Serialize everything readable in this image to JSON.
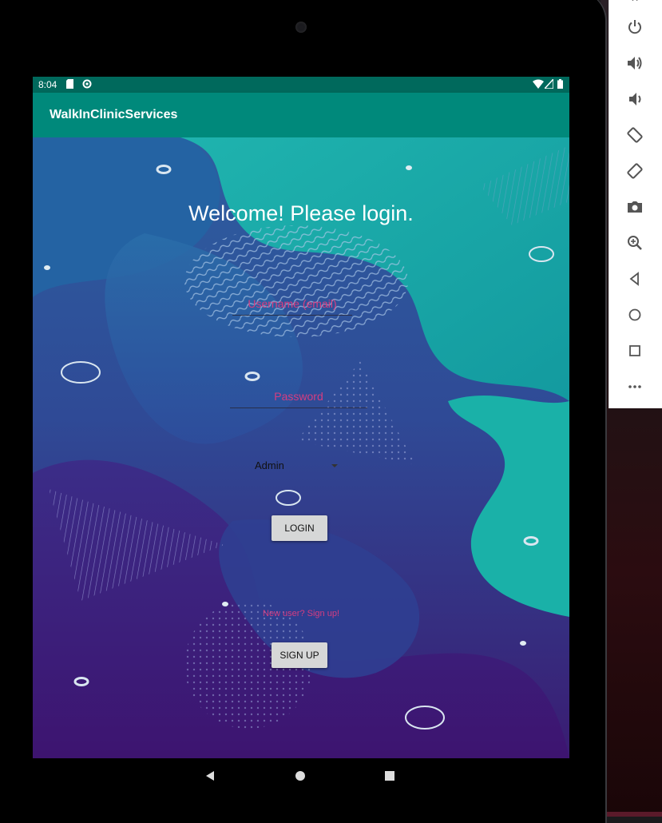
{
  "status_bar": {
    "time": "8:04"
  },
  "app": {
    "title": "WalkInClinicServices"
  },
  "login_form": {
    "welcome_text": "Welcome! Please login.",
    "username_placeholder": "Username (email)",
    "password_placeholder": "Password",
    "role_selected": "Admin",
    "login_label": "LOGIN",
    "signup_prompt": "New user? Sign up!",
    "signup_label": "SIGN UP"
  },
  "nav_bar": {
    "items": [
      "back-icon",
      "home-icon",
      "recents-icon"
    ]
  },
  "emulator_toolbar": {
    "items": [
      "power-icon",
      "volume-up-icon",
      "volume-down-icon",
      "rotate-left-icon",
      "rotate-right-icon",
      "camera-icon",
      "zoom-icon",
      "back-icon",
      "home-icon",
      "overview-icon",
      "more-icon"
    ]
  },
  "colors": {
    "status_bar": "#00695c",
    "app_bar": "#00897b",
    "hint_text": "#d63d80",
    "button": "#d6d7d7"
  }
}
